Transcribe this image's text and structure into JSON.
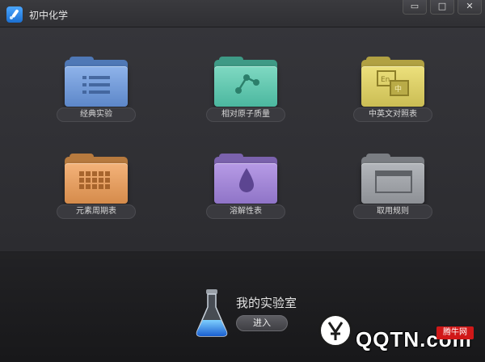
{
  "window": {
    "title": "初中化学",
    "buttons": {
      "minimize": "▭",
      "maximize": "□",
      "close": "✕"
    }
  },
  "modules": [
    {
      "label": "经典实验",
      "color": "blue",
      "icon": "list-icon"
    },
    {
      "label": "相对原子质量",
      "color": "green",
      "icon": "molecule-icon"
    },
    {
      "label": "中英文对照表",
      "color": "yellow",
      "icon": "translate-icon"
    },
    {
      "label": "元素周期表",
      "color": "orange",
      "icon": "grid-icon"
    },
    {
      "label": "溶解性表",
      "color": "purple",
      "icon": "drop-icon"
    },
    {
      "label": "取用规则",
      "color": "gray",
      "icon": "window-icon"
    }
  ],
  "lab": {
    "title": "我的实验室",
    "enter_label": "进入"
  },
  "watermark": {
    "text": "QQTN.com",
    "tag": "腾牛网"
  }
}
